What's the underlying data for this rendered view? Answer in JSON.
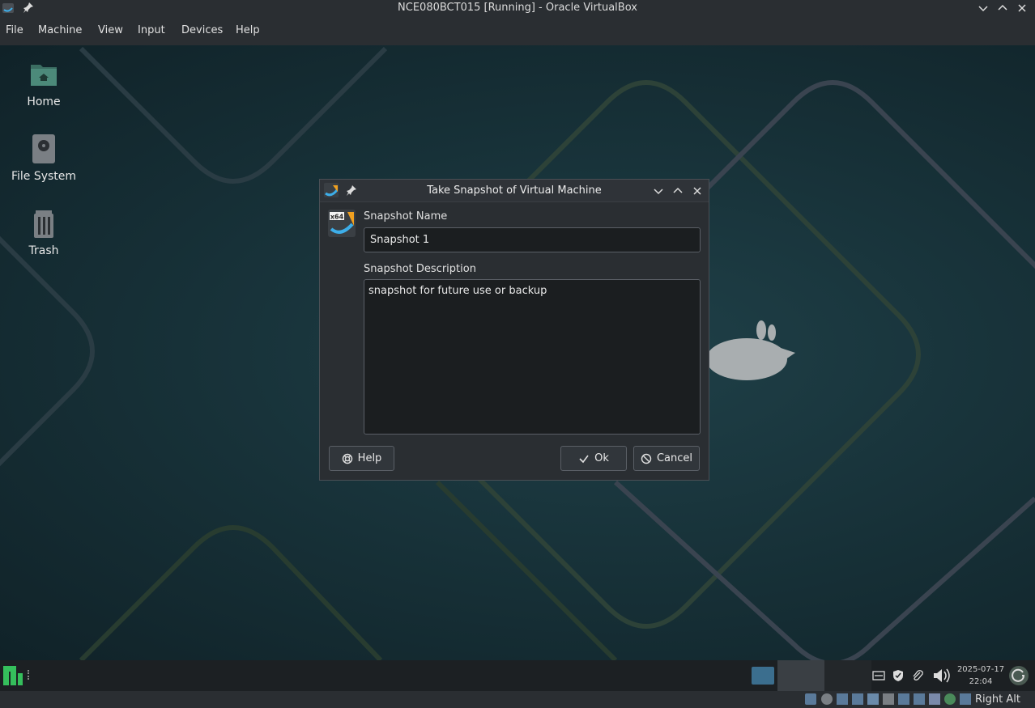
{
  "host": {
    "title": "NCE080BCT015 [Running] - Oracle VirtualBox",
    "menu": [
      "File",
      "Machine",
      "View",
      "Input",
      "Devices",
      "Help"
    ],
    "status_right": "Right Alt"
  },
  "desktop": {
    "icons": [
      {
        "label": "Home",
        "icon": "home-folder-icon"
      },
      {
        "label": "File System",
        "icon": "drive-icon"
      },
      {
        "label": "Trash",
        "icon": "trash-icon"
      }
    ]
  },
  "dialog": {
    "title": "Take Snapshot of Virtual Machine",
    "name_label": "Snapshot Name",
    "name_value": "Snapshot 1",
    "desc_label": "Snapshot Description",
    "desc_value": "snapshot for future use or backup",
    "help_label": "Help",
    "ok_label": "Ok",
    "cancel_label": "Cancel",
    "badge": "x64"
  },
  "taskbar": {
    "date": "2025-07-17",
    "time": "22:04"
  },
  "colors": {
    "accent": "#3daee9",
    "dialog_bg": "#2a2e32",
    "desktop_bg": "#173138"
  }
}
